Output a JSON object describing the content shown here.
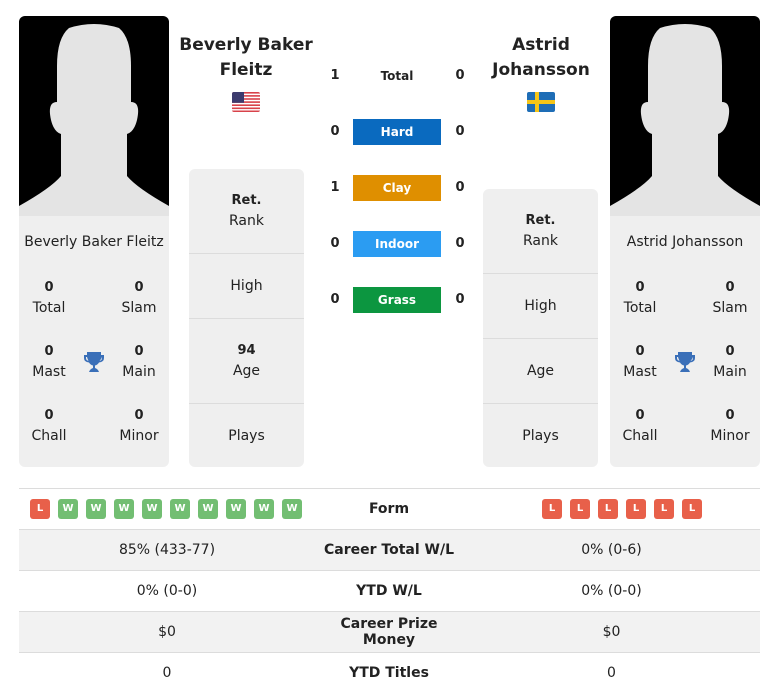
{
  "player1": {
    "name": "Beverly Baker Fleitz",
    "flag": "usa-flag",
    "titles": [
      {
        "value": "0",
        "label": "Total"
      },
      {
        "value": "0",
        "label": "Slam"
      },
      {
        "value": "0",
        "label": "Mast"
      },
      {
        "value": "0",
        "label": "Main"
      },
      {
        "value": "0",
        "label": "Chall"
      },
      {
        "value": "0",
        "label": "Minor"
      }
    ],
    "info": [
      {
        "value": "Ret.",
        "label": "Rank"
      },
      {
        "value": "",
        "label": "High"
      },
      {
        "value": "94",
        "label": "Age"
      },
      {
        "value": "",
        "label": "Plays"
      }
    ],
    "form": [
      "L",
      "W",
      "W",
      "W",
      "W",
      "W",
      "W",
      "W",
      "W",
      "W"
    ]
  },
  "player2": {
    "name": "Astrid Johansson",
    "flag": "sweden-flag",
    "titles": [
      {
        "value": "0",
        "label": "Total"
      },
      {
        "value": "0",
        "label": "Slam"
      },
      {
        "value": "0",
        "label": "Mast"
      },
      {
        "value": "0",
        "label": "Main"
      },
      {
        "value": "0",
        "label": "Chall"
      },
      {
        "value": "0",
        "label": "Minor"
      }
    ],
    "info": [
      {
        "value": "Ret.",
        "label": "Rank"
      },
      {
        "value": "",
        "label": "High"
      },
      {
        "value": "",
        "label": "Age"
      },
      {
        "value": "",
        "label": "Plays"
      }
    ],
    "form": [
      "L",
      "L",
      "L",
      "L",
      "L",
      "L"
    ]
  },
  "h2h": [
    {
      "label": "Total",
      "left": "1",
      "right": "0",
      "color": ""
    },
    {
      "label": "Hard",
      "left": "0",
      "right": "0",
      "color": "#0a6abf"
    },
    {
      "label": "Clay",
      "left": "1",
      "right": "0",
      "color": "#df8f00"
    },
    {
      "label": "Indoor",
      "left": "0",
      "right": "0",
      "color": "#2b9cf2"
    },
    {
      "label": "Grass",
      "left": "0",
      "right": "0",
      "color": "#0c9640"
    }
  ],
  "stats": [
    {
      "label": "Form",
      "left": "",
      "right": ""
    },
    {
      "label": "Career Total W/L",
      "left": "85% (433-77)",
      "right": "0% (0-6)"
    },
    {
      "label": "YTD W/L",
      "left": "0% (0-0)",
      "right": "0% (0-0)"
    },
    {
      "label": "Career Prize Money",
      "left": "$0",
      "right": "$0"
    },
    {
      "label": "YTD Titles",
      "left": "0",
      "right": "0"
    }
  ],
  "colors": {
    "win": "#72be72",
    "loss": "#e8604a",
    "trophy": "#3a6fb8"
  }
}
